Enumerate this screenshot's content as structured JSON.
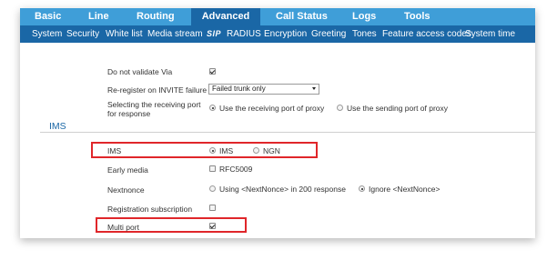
{
  "top_nav": {
    "basic": "Basic",
    "line": "Line",
    "routing": "Routing",
    "advanced": "Advanced",
    "call_status": "Call Status",
    "logs": "Logs",
    "tools": "Tools"
  },
  "sub_nav": {
    "system": "System",
    "security": "Security",
    "white_list": "White list",
    "media_stream": "Media stream",
    "sip": "SIP",
    "radius": "RADIUS",
    "encryption": "Encryption",
    "greeting": "Greeting",
    "tones": "Tones",
    "feature_access_codes": "Feature access codes",
    "system_time": "System time"
  },
  "settings": {
    "do_not_validate_via": {
      "label": "Do not validate Via",
      "checked": true
    },
    "reregister": {
      "label": "Re-register on INVITE failure",
      "value": "Failed trunk only"
    },
    "receiving_port": {
      "label_line1": "Selecting the receiving port",
      "label_line2": "for response",
      "option1": "Use the receiving port of proxy",
      "option2": "Use the sending port of proxy",
      "selected": 1
    }
  },
  "ims_section": {
    "title": "IMS",
    "ims": {
      "label": "IMS",
      "option1": "IMS",
      "option2": "NGN",
      "selected": 1
    },
    "early_media": {
      "label": "Early media",
      "option": "RFC5009",
      "checked": false
    },
    "nextnonce": {
      "label": "Nextnonce",
      "option1": "Using <NextNonce> in 200 response",
      "option2": "Ignore <NextNonce>",
      "selected": 2
    },
    "registration_subscription": {
      "label": "Registration subscription",
      "checked": false
    },
    "multi_port": {
      "label": "Multi port",
      "checked": true
    }
  },
  "colors": {
    "top_nav_bg": "#3f9ed8",
    "active_tab_bg": "#1a67a6",
    "sub_nav_bg": "#1a67a6",
    "highlight_border": "#e0262a",
    "section_title": "#1a67a6"
  }
}
